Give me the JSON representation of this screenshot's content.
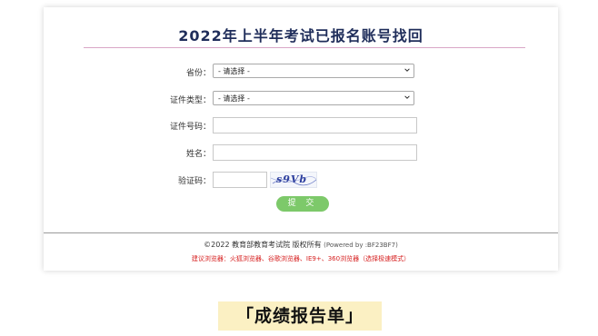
{
  "page": {
    "title": "2022年上半年考试已报名账号找回",
    "caption": "「成绩报告单」"
  },
  "form": {
    "province": {
      "label": "省份：",
      "value": "- 请选择 -"
    },
    "id_type": {
      "label": "证件类型：",
      "value": "- 请选择 -"
    },
    "id_number": {
      "label": "证件号码：",
      "value": ""
    },
    "name": {
      "label": "姓名：",
      "value": ""
    },
    "captcha": {
      "label": "验证码：",
      "value": "",
      "image_text": "s9Vb"
    },
    "submit_label": "提 交"
  },
  "footer": {
    "copyright": "©2022 教育部教育考试院 版权所有",
    "powered": "(Powered by :BF23BF7)",
    "browser_tip": "建议浏览器：火狐浏览器、谷歌浏览器、IE9+、360浏览器（选择极速模式）"
  },
  "colors": {
    "title": "#1f2d5a",
    "accent_rule": "#d9a6c6",
    "submit_button": "#7dc96a",
    "tip_text": "#d61f1f",
    "caption_bg": "#fbf0c3"
  },
  "icons": {
    "select_arrow": "chevron-down-icon"
  }
}
